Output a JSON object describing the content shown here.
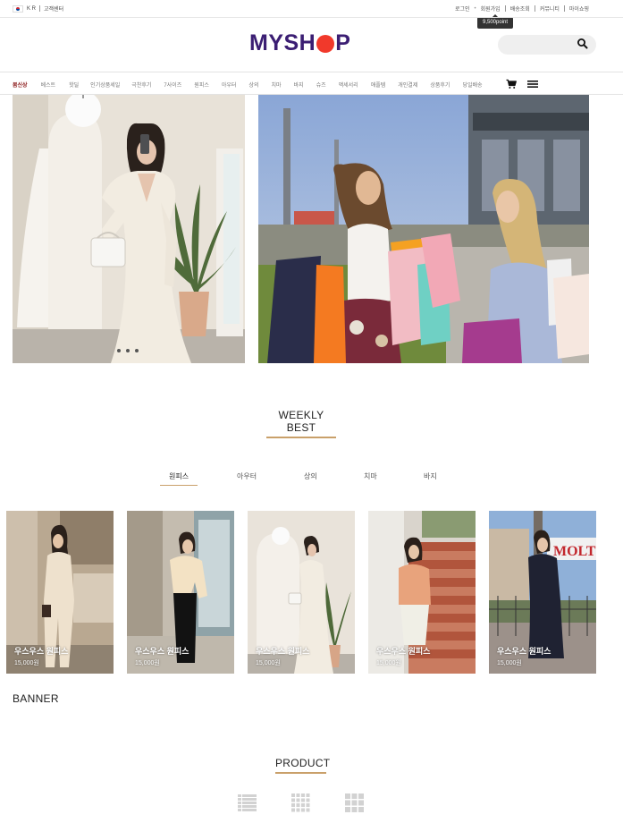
{
  "topbar": {
    "lang": "K R",
    "customer_center": "고객센터",
    "links": [
      "로그인",
      "회원가입",
      "배송조회",
      "커뮤니티",
      "마이쇼핑"
    ],
    "tooltip": "9,500point"
  },
  "logo": {
    "text_left": "MYSH",
    "text_right": "P"
  },
  "search": {
    "placeholder": "",
    "value": ""
  },
  "nav": {
    "items": [
      "봄신상",
      "베스트",
      "핫딜",
      "인기상품세일",
      "극찬후기",
      "7사이즈",
      "원피스",
      "아우터",
      "상의",
      "치마",
      "바지",
      "슈즈",
      "액세서리",
      "애플템",
      "개인결제",
      "상품후기",
      "당일배송"
    ],
    "active_index": 0
  },
  "icons": {
    "cart": "cart-icon",
    "menu": "hamburger-menu-icon",
    "search": "search-icon"
  },
  "hero": {
    "slide_count": 3,
    "active_slide": 0
  },
  "weekly_best": {
    "title": "WEEKLY BEST",
    "tabs": [
      "원피스",
      "아우터",
      "상의",
      "치마",
      "바지"
    ],
    "active_tab": 0,
    "products": [
      {
        "name": "우스우스 원피스",
        "price": "15,000원"
      },
      {
        "name": "우스우스 원피스",
        "price": "15,000원"
      },
      {
        "name": "우스우스 원피스",
        "price": "15,000원"
      },
      {
        "name": "우스우스 원피스",
        "price": "15,000원"
      },
      {
        "name": "우스우스 원피스",
        "price": "15,000원"
      }
    ]
  },
  "banner": {
    "label": "BANNER"
  },
  "product": {
    "title": "PRODUCT",
    "view_modes": [
      "list-view-icon",
      "grid-4-view-icon",
      "grid-3-view-icon"
    ]
  },
  "colors": {
    "logo": "#3b1e73",
    "logo_accent": "#f1392b",
    "active_nav": "#8b1a1a",
    "underline": "#c9a06a"
  }
}
